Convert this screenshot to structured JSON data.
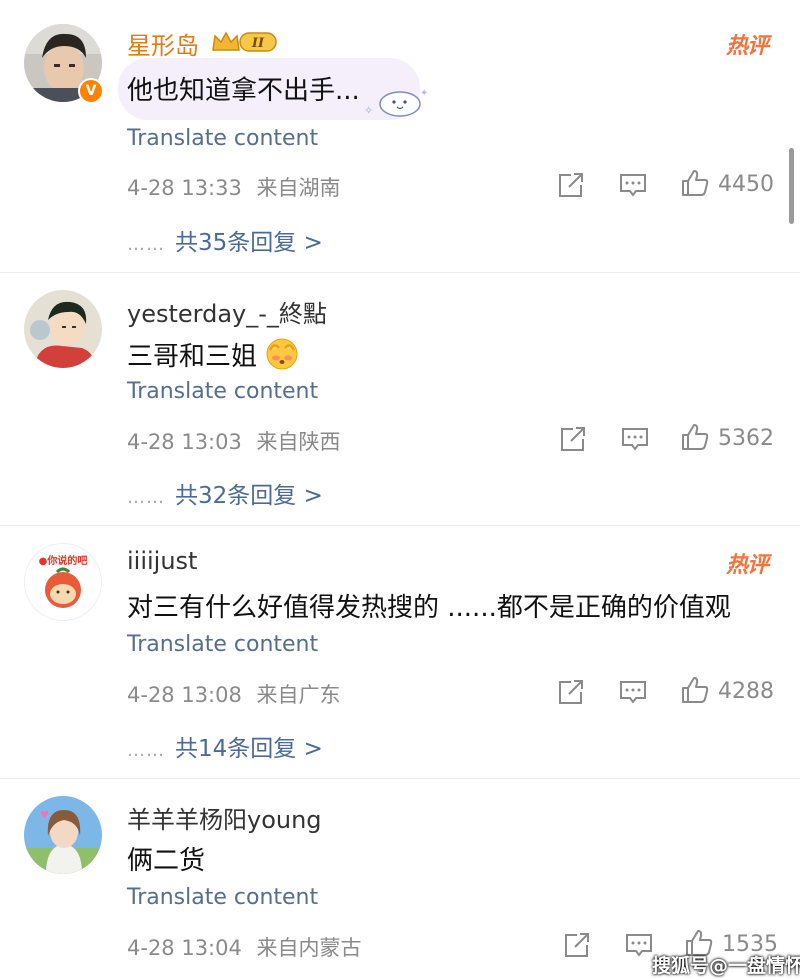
{
  "comments": [
    {
      "username": "星形岛",
      "crown_level": "II",
      "hot_tag": "热评",
      "verified": "V",
      "text": "他也知道拿不出手...",
      "translate": "Translate content",
      "time": "4-28 13:33",
      "location": "来自湖南",
      "likes": "4450",
      "replies_label": "共35条回复 >",
      "dots": "……"
    },
    {
      "username": "yesterday_-_終點",
      "text": "三哥和三姐",
      "translate": "Translate content",
      "time": "4-28 13:03",
      "location": "来自陕西",
      "likes": "5362",
      "replies_label": "共32条回复 >",
      "dots": "……"
    },
    {
      "username": "iiiijust",
      "hot_tag": "热评",
      "avatar_text": "●你说的吧",
      "text": "对三有什么好值得发热搜的 ......都不是正确的价值观",
      "translate": "Translate content",
      "time": "4-28 13:08",
      "location": "来自广东",
      "likes": "4288",
      "replies_label": "共14条回复 >",
      "dots": "……"
    },
    {
      "username": "羊羊羊杨阳young",
      "text": "俩二货",
      "translate": "Translate content",
      "time": "4-28 13:04",
      "location": "来自内蒙古",
      "likes": "1535"
    }
  ],
  "watermark": "搜狐号@一盘情怀",
  "icons": {
    "share": "share-icon",
    "comment": "comment-icon",
    "like": "thumbs-up-icon"
  },
  "colors": {
    "username_vip": "#e07b1a",
    "link": "#4c6a97",
    "hot_tag": "#f2733d",
    "verified_badge": "#ff8200"
  }
}
